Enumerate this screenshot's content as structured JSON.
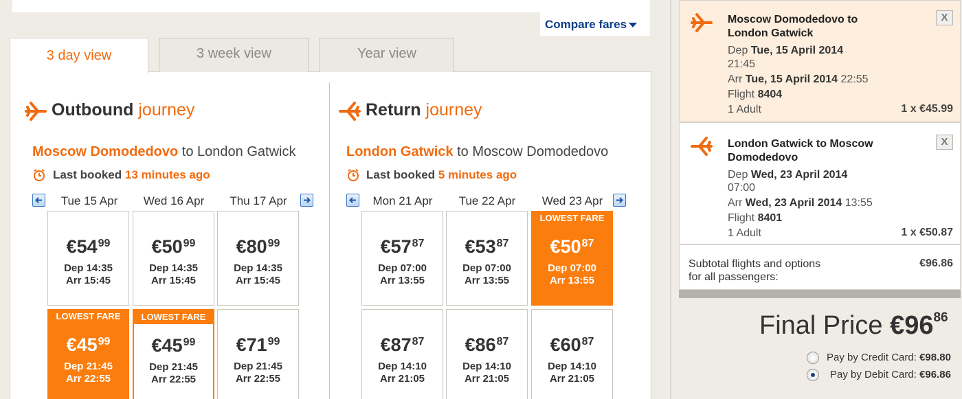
{
  "compare": {
    "label": "Compare fares"
  },
  "tabs": [
    {
      "label": "3 day view"
    },
    {
      "label": "3 week view"
    },
    {
      "label": "Year view"
    }
  ],
  "outbound": {
    "title_main": "Outbound",
    "title_sub": "journey",
    "origin": "Moscow Domodedovo",
    "to_word": "to",
    "destination": "London Gatwick",
    "booked_prefix": "Last booked",
    "booked_ago": "13 minutes ago",
    "days": [
      "Tue 15 Apr",
      "Wed 16 Apr",
      "Thu 17 Apr"
    ],
    "fares": [
      {
        "euros": "€54",
        "cents": "99",
        "dep": "Dep 14:35",
        "arr": "Arr 15:45",
        "badge": ""
      },
      {
        "euros": "€50",
        "cents": "99",
        "dep": "Dep 14:35",
        "arr": "Arr 15:45",
        "badge": ""
      },
      {
        "euros": "€80",
        "cents": "99",
        "dep": "Dep 14:35",
        "arr": "Arr 15:45",
        "badge": ""
      },
      {
        "euros": "€45",
        "cents": "99",
        "dep": "Dep 21:45",
        "arr": "Arr 22:55",
        "badge": "LOWEST FARE"
      },
      {
        "euros": "€45",
        "cents": "99",
        "dep": "Dep 21:45",
        "arr": "Arr 22:55",
        "badge": "LOWEST FARE"
      },
      {
        "euros": "€71",
        "cents": "99",
        "dep": "Dep 21:45",
        "arr": "Arr 22:55",
        "badge": ""
      }
    ]
  },
  "return": {
    "title_main": "Return",
    "title_sub": "journey",
    "origin": "London Gatwick",
    "to_word": "to",
    "destination": "Moscow Domodedovo",
    "booked_prefix": "Last booked",
    "booked_ago": "5 minutes ago",
    "days": [
      "Mon 21 Apr",
      "Tue 22 Apr",
      "Wed 23 Apr"
    ],
    "fares": [
      {
        "euros": "€57",
        "cents": "87",
        "dep": "Dep 07:00",
        "arr": "Arr 13:55",
        "badge": ""
      },
      {
        "euros": "€53",
        "cents": "87",
        "dep": "Dep 07:00",
        "arr": "Arr 13:55",
        "badge": ""
      },
      {
        "euros": "€50",
        "cents": "87",
        "dep": "Dep 07:00",
        "arr": "Arr 13:55",
        "badge": "LOWEST FARE"
      },
      {
        "euros": "€87",
        "cents": "87",
        "dep": "Dep 14:10",
        "arr": "Arr 21:05",
        "badge": ""
      },
      {
        "euros": "€86",
        "cents": "87",
        "dep": "Dep 14:10",
        "arr": "Arr 21:05",
        "badge": ""
      },
      {
        "euros": "€60",
        "cents": "87",
        "dep": "Dep 14:10",
        "arr": "Arr 21:05",
        "badge": ""
      }
    ]
  },
  "summary": {
    "flight1": {
      "route": "Moscow Domodedovo to London Gatwick",
      "dep_prefix": "Dep",
      "dep_date": "Tue, 15 April 2014",
      "dep_time": "21:45",
      "arr_prefix": "Arr",
      "arr_date": "Tue, 15 April 2014",
      "arr_time": "22:55",
      "flight_prefix": "Flight",
      "flight_no": "8404",
      "pax": "1 Adult",
      "price": "1 x €45.99",
      "close": "X"
    },
    "flight2": {
      "route": "London Gatwick to Moscow Domodedovo",
      "dep_prefix": "Dep",
      "dep_date": "Wed, 23 April 2014",
      "dep_time": "07:00",
      "arr_prefix": "Arr",
      "arr_date": "Wed, 23 April 2014",
      "arr_time": "13:55",
      "flight_prefix": "Flight",
      "flight_no": "8401",
      "pax": "1 Adult",
      "price": "1 x €50.87",
      "close": "X"
    },
    "subtotal_label_1": "Subtotal flights and options",
    "subtotal_label_2": "for all passengers:",
    "subtotal_value": "€96.86"
  },
  "final": {
    "label": "Final Price",
    "euros": "€96",
    "cents": "86",
    "pay_credit_label": "Pay by Credit Card:",
    "pay_credit_value": "€98.80",
    "pay_debit_label": "Pay by Debit Card:",
    "pay_debit_value": "€96.86",
    "selected": "debit"
  },
  "colors": {
    "accent": "#fb7d0d",
    "link": "#0b3e8a"
  }
}
